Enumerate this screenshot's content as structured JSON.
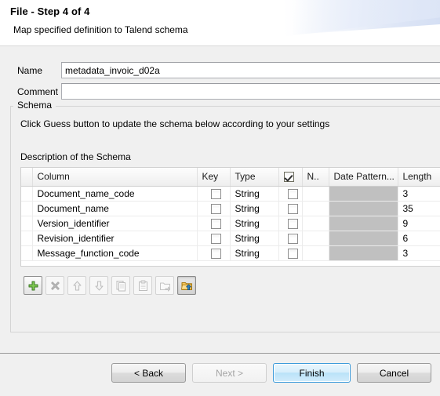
{
  "header": {
    "title": "File - Step 4 of 4",
    "subtitle": "Map specified definition to Talend schema"
  },
  "form": {
    "name_label": "Name",
    "name_value": "metadata_invoic_d02a",
    "name_placeholder": "",
    "comment_label": "Comment",
    "comment_value": "",
    "comment_placeholder": ""
  },
  "schema_group": {
    "legend": "Schema",
    "hint": "Click Guess button to update the schema below according to your settings",
    "table_caption": "Description of the Schema"
  },
  "table": {
    "headers": {
      "gutter": "",
      "column": "Column",
      "key": "Key",
      "type": "Type",
      "nullable_check": "",
      "nullable": "N..",
      "date_pattern": "Date Pattern...",
      "length": "Length"
    },
    "header_nullable_checked": true,
    "rows": [
      {
        "column": "Document_name_code",
        "key": false,
        "type": "String",
        "nullable": false,
        "date_pattern": "",
        "length": "3"
      },
      {
        "column": "Document_name",
        "key": false,
        "type": "String",
        "nullable": false,
        "date_pattern": "",
        "length": "35"
      },
      {
        "column": "Version_identifier",
        "key": false,
        "type": "String",
        "nullable": false,
        "date_pattern": "",
        "length": "9"
      },
      {
        "column": "Revision_identifier",
        "key": false,
        "type": "String",
        "nullable": false,
        "date_pattern": "",
        "length": "6"
      },
      {
        "column": "Message_function_code",
        "key": false,
        "type": "String",
        "nullable": false,
        "date_pattern": "",
        "length": "3"
      }
    ]
  },
  "toolbar": {
    "buttons": [
      {
        "name": "add-column-button",
        "icon": "plus-icon",
        "state": "enabled"
      },
      {
        "name": "delete-column-button",
        "icon": "cross-icon",
        "state": "disabled"
      },
      {
        "name": "move-up-button",
        "icon": "arrow-up-icon",
        "state": "disabled"
      },
      {
        "name": "move-down-button",
        "icon": "arrow-down-icon",
        "state": "disabled"
      },
      {
        "name": "copy-button",
        "icon": "copy-icon",
        "state": "disabled"
      },
      {
        "name": "paste-button",
        "icon": "paste-icon",
        "state": "disabled"
      },
      {
        "name": "export-schema-button",
        "icon": "export-icon",
        "state": "disabled"
      },
      {
        "name": "import-schema-button",
        "icon": "folder-up-icon",
        "state": "active"
      }
    ]
  },
  "footer": {
    "back": "< Back",
    "next": "Next >",
    "finish": "Finish",
    "cancel": "Cancel"
  },
  "colors": {
    "accent": "#3c9bda",
    "disabled_cell": "#c0c0c0",
    "dialog_bg": "#f0f0f0"
  }
}
